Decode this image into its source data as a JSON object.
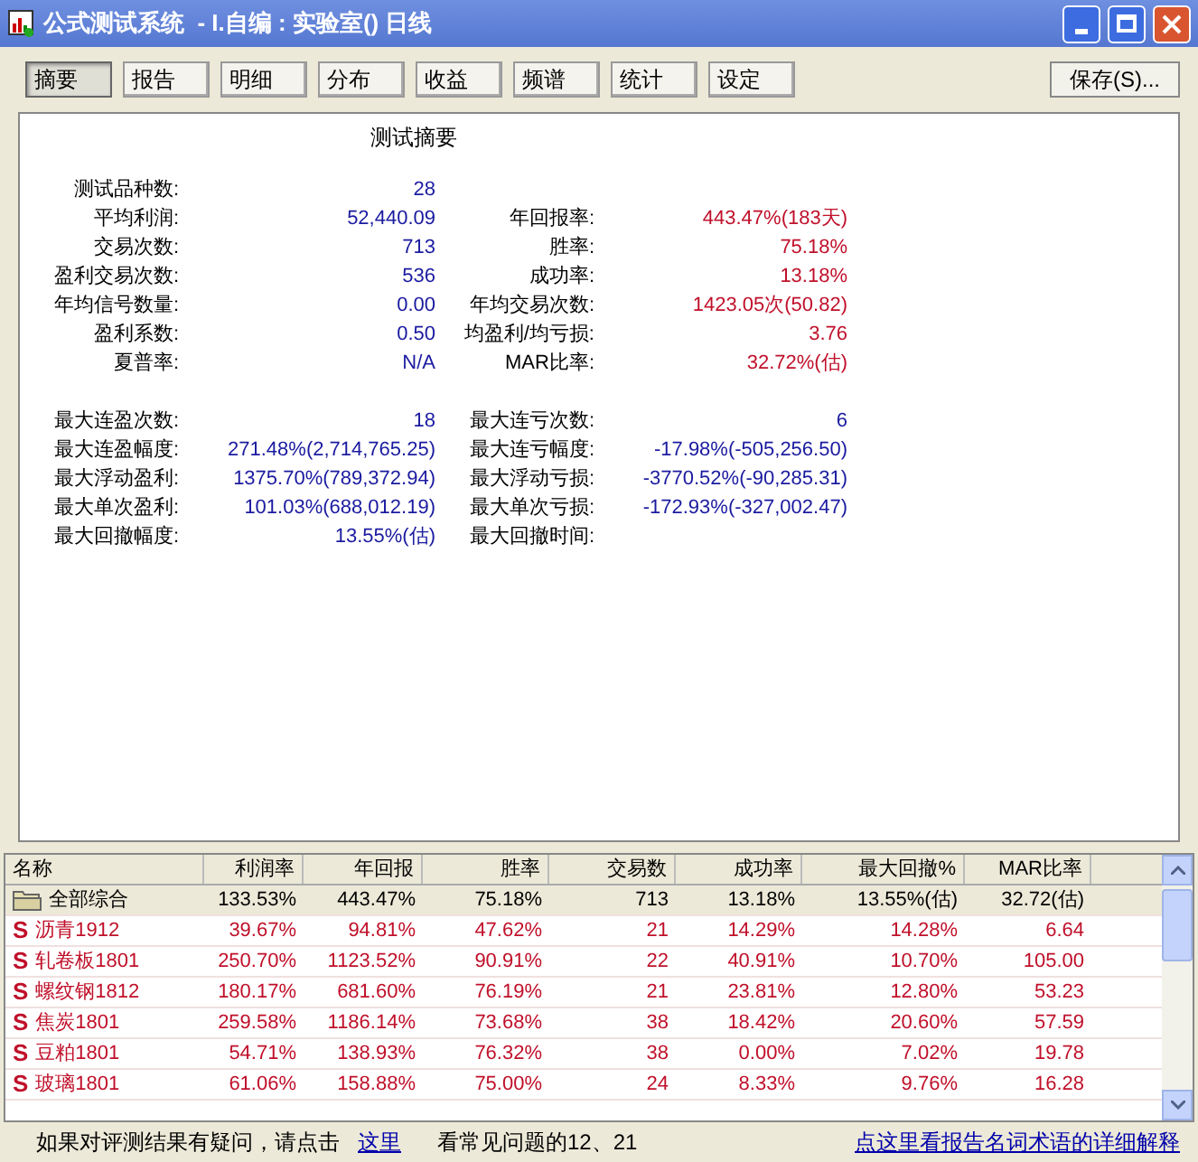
{
  "window": {
    "title": "公式测试系统  - I.自编 : 实验室() 日线"
  },
  "tabs": [
    {
      "label": "摘要",
      "selected": true
    },
    {
      "label": "报告",
      "selected": false
    },
    {
      "label": "明细",
      "selected": false
    },
    {
      "label": "分布",
      "selected": false
    },
    {
      "label": "收益",
      "selected": false
    },
    {
      "label": "频谱",
      "selected": false
    },
    {
      "label": "统计",
      "selected": false
    },
    {
      "label": "设定",
      "selected": false
    }
  ],
  "save_button": "保存(S)...",
  "summary": {
    "title": "测试摘要",
    "groups": [
      [
        {
          "label": "测试品种数:",
          "value": "28"
        },
        {
          "label": "平均利润:",
          "value": "52,440.09",
          "label2": "年回报率:",
          "value2": "443.47%(183天)",
          "emphasis2": true
        },
        {
          "label": "交易次数:",
          "value": "713",
          "label2": "胜率:",
          "value2": "75.18%",
          "emphasis2": true
        },
        {
          "label": "盈利交易次数:",
          "value": "536",
          "label2": "成功率:",
          "value2": "13.18%",
          "emphasis2": true
        },
        {
          "label": "年均信号数量:",
          "value": "0.00",
          "label2": "年均交易次数:",
          "value2": "1423.05次(50.82)",
          "emphasis2": true
        },
        {
          "label": "盈利系数:",
          "value": "0.50",
          "label2": "均盈利/均亏损:",
          "value2": "3.76",
          "emphasis2": true
        },
        {
          "label": "夏普率:",
          "value": "N/A",
          "label2": "MAR比率:",
          "value2": "32.72%(估)",
          "emphasis2": true
        }
      ],
      [
        {
          "label": "最大连盈次数:",
          "value": "18",
          "label2": "最大连亏次数:",
          "value2": "6",
          "emphasis2": false
        },
        {
          "label": "最大连盈幅度:",
          "value": "271.48%(2,714,765.25)",
          "label2": "最大连亏幅度:",
          "value2": "-17.98%(-505,256.50)",
          "emphasis2": false
        },
        {
          "label": "最大浮动盈利:",
          "value": "1375.70%(789,372.94)",
          "label2": "最大浮动亏损:",
          "value2": "-3770.52%(-90,285.31)",
          "emphasis2": false
        },
        {
          "label": "最大单次盈利:",
          "value": "101.03%(688,012.19)",
          "label2": "最大单次亏损:",
          "value2": "-172.93%(-327,002.47)",
          "emphasis2": false
        },
        {
          "label": "最大回撤幅度:",
          "value": "13.55%(估)",
          "label2": "最大回撤时间:"
        }
      ]
    ]
  },
  "table": {
    "columns": [
      "名称",
      "利润率",
      "年回报",
      "胜率",
      "交易数",
      "成功率",
      "最大回撤%",
      "MAR比率"
    ],
    "rows": [
      {
        "kind": "group",
        "cells": [
          "全部综合",
          "133.53%",
          "443.47%",
          "75.18%",
          "713",
          "13.18%",
          "13.55%(估)",
          "32.72(估)"
        ]
      },
      {
        "kind": "instrument",
        "icon": "S",
        "cells": [
          "沥青1912",
          "39.67%",
          "94.81%",
          "47.62%",
          "21",
          "14.29%",
          "14.28%",
          "6.64"
        ]
      },
      {
        "kind": "instrument",
        "icon": "S",
        "cells": [
          "轧卷板1801",
          "250.70%",
          "1123.52%",
          "90.91%",
          "22",
          "40.91%",
          "10.70%",
          "105.00"
        ]
      },
      {
        "kind": "instrument",
        "icon": "S",
        "cells": [
          "螺纹钢1812",
          "180.17%",
          "681.60%",
          "76.19%",
          "21",
          "23.81%",
          "12.80%",
          "53.23"
        ]
      },
      {
        "kind": "instrument",
        "icon": "S",
        "cells": [
          "焦炭1801",
          "259.58%",
          "1186.14%",
          "73.68%",
          "38",
          "18.42%",
          "20.60%",
          "57.59"
        ]
      },
      {
        "kind": "instrument",
        "icon": "S",
        "cells": [
          "豆粕1801",
          "54.71%",
          "138.93%",
          "76.32%",
          "38",
          "0.00%",
          "7.02%",
          "19.78"
        ]
      },
      {
        "kind": "instrument",
        "icon": "S",
        "cells": [
          "玻璃1801",
          "61.06%",
          "158.88%",
          "75.00%",
          "24",
          "8.33%",
          "9.76%",
          "16.28"
        ]
      }
    ]
  },
  "footer": {
    "prompt": "如果对评测结果有疑问，请点击",
    "link": "这里",
    "note": "看常见问题的12、21",
    "help_link": "点这里看报告名词术语的详细解释"
  }
}
